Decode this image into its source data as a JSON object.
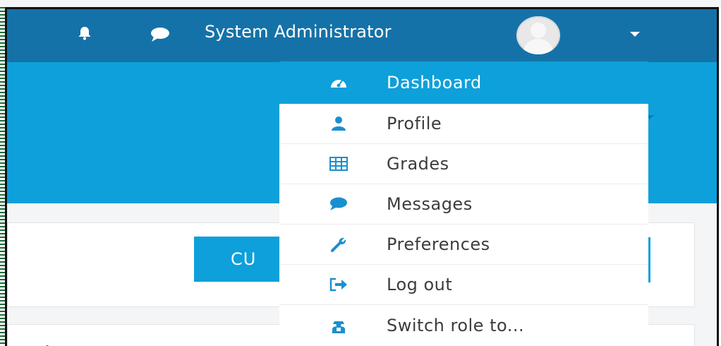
{
  "navbar": {
    "username": "System Administrator",
    "icons": {
      "notifications": "bell-icon",
      "messages": "chat-icon",
      "menu_toggle": "caret-down-icon"
    }
  },
  "user_menu": {
    "items": [
      {
        "label": "Dashboard",
        "icon": "dashboard-icon",
        "active": true
      },
      {
        "label": "Profile",
        "icon": "user-icon",
        "active": false
      },
      {
        "label": "Grades",
        "icon": "table-icon",
        "active": false
      },
      {
        "label": "Messages",
        "icon": "chat-icon",
        "active": false
      },
      {
        "label": "Preferences",
        "icon": "wrench-icon",
        "active": false
      },
      {
        "label": "Log out",
        "icon": "sign-out-icon",
        "active": false
      },
      {
        "label": "Switch role to...",
        "icon": "user-secret-icon",
        "active": false
      }
    ]
  },
  "page": {
    "partial_button_label": "CU"
  },
  "colors": {
    "navbar": "#1572a8",
    "header": "#0ea0da",
    "active_item": "#0ea0da",
    "menu_icon": "#1a8fcf",
    "menu_text": "#3c3c3c"
  }
}
